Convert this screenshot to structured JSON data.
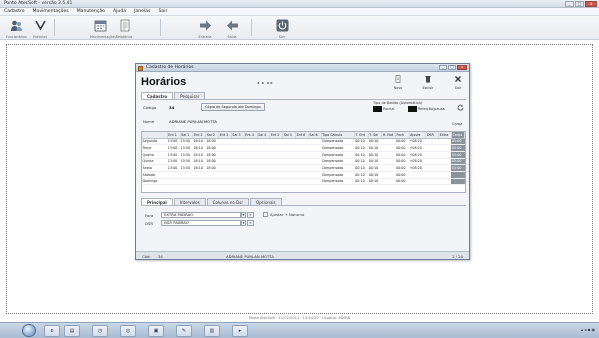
{
  "app": {
    "title": "Ponto AtecSoft - versão 3.5.41",
    "menu": [
      "Cadastro",
      "Movimentações",
      "Manutenção",
      "Ajuda",
      "Janelas",
      "Sair"
    ],
    "toolbar": [
      {
        "label": "Funcionários",
        "icon": "people-icon"
      },
      {
        "label": "Horários",
        "icon": "clock-icon"
      },
      {
        "label": "Movimentações",
        "icon": "calendar-icon"
      },
      {
        "label": "Relatórios",
        "icon": "document-icon"
      },
      {
        "label": "Entrada",
        "icon": "arrow-right-icon"
      },
      {
        "label": "Saída",
        "icon": "arrow-left-icon"
      },
      {
        "label": "Sair",
        "icon": "power-icon"
      }
    ],
    "status_line": "Ponto AtecSoft · 11/02/2013 · 13:44:22 · Usuário: ADMIN"
  },
  "dialog": {
    "title": "Cadastro de Horários",
    "heading": "Horários",
    "nav_text": "◂ ▸ ▸▸",
    "actions": [
      {
        "label": "Novo",
        "icon": "new-icon"
      },
      {
        "label": "Excluir",
        "icon": "delete-icon"
      },
      {
        "label": "Sair",
        "icon": "exit-icon"
      }
    ],
    "tabs": [
      "Cadastro",
      "Pesquisar"
    ],
    "active_tab": "Cadastro",
    "codigo_label": "Código",
    "codigo_value": "34",
    "button_copy": "Cópia de Segunda até Domingo",
    "tipo_label": "Tipo de Batida (Automática)",
    "legend": [
      {
        "label": "Parcial",
        "color": "#111111"
      },
      {
        "label": "Refeição/pausa",
        "color": "#111111"
      }
    ],
    "nome_label": "Nome",
    "nome_value": "ADRIANE PURLAN MOTTA",
    "carga_label": "Carga",
    "grid": {
      "columns": [
        "",
        "Ent 1",
        "Saí 1",
        "Ent 2",
        "Saí 2",
        "Ent 3",
        "Saí 3",
        "Ent 4",
        "Saí 4",
        "Ent 5",
        "Saí 5",
        "Ent 6",
        "Saí 6",
        "Tipo Cálculo",
        "T. Ent",
        "T. Saí",
        "H. Not",
        "Fech",
        "Ajuste",
        "DSR",
        "Extra",
        "Carga"
      ],
      "rows": [
        [
          "Segunda",
          "13:00",
          "15:50",
          "16:10",
          "18:00",
          "",
          "",
          "",
          "",
          "",
          "",
          "",
          "",
          "Compensado",
          "00:10",
          "00:10",
          "",
          "00:00",
          "+08:20",
          "",
          "",
          "05:00"
        ],
        [
          "Terça",
          "13:00",
          "15:50",
          "16:10",
          "18:00",
          "",
          "",
          "",
          "",
          "",
          "",
          "",
          "",
          "Compensado",
          "00:10",
          "00:10",
          "",
          "00:00",
          "+08:20",
          "",
          "",
          "05:00"
        ],
        [
          "Quarta",
          "13:00",
          "15:50",
          "16:10",
          "18:00",
          "",
          "",
          "",
          "",
          "",
          "",
          "",
          "",
          "Compensado",
          "00:10",
          "00:10",
          "",
          "00:00",
          "+08:20",
          "",
          "",
          "05:00"
        ],
        [
          "Quinta",
          "13:00",
          "15:50",
          "16:10",
          "18:00",
          "",
          "",
          "",
          "",
          "",
          "",
          "",
          "",
          "Compensado",
          "00:10",
          "00:10",
          "",
          "00:00",
          "+08:20",
          "",
          "",
          "05:00"
        ],
        [
          "Sexta",
          "13:00",
          "15:50",
          "16:10",
          "18:00",
          "",
          "",
          "",
          "",
          "",
          "",
          "",
          "",
          "Compensado",
          "00:10",
          "00:10",
          "",
          "00:00",
          "+08:20",
          "",
          "",
          "05:00"
        ],
        [
          "Sábado",
          "",
          "",
          "",
          "",
          "",
          "",
          "",
          "",
          "",
          "",
          "",
          "",
          "Compensado",
          "00:10",
          "00:10",
          "",
          "00:00",
          "",
          "",
          "",
          ""
        ],
        [
          "Domingo",
          "",
          "",
          "",
          "",
          "",
          "",
          "",
          "",
          "",
          "",
          "",
          "",
          "Compensado",
          "00:10",
          "00:10",
          "",
          "00:00",
          "",
          "",
          "",
          ""
        ]
      ]
    },
    "subtabs": [
      "Principal",
      "Intervalos",
      "Colunas no Dsr",
      "Opcionais"
    ],
    "active_subtab": "Principal",
    "fields": [
      {
        "label": "Fora",
        "value": "EXTRA PADRÃO"
      },
      {
        "label": "DSR",
        "value": "DSR PADRÃO"
      }
    ],
    "checkbox_label": "Ajustar + Noturno",
    "status": {
      "left": "Cód:",
      "code": "34",
      "name": "ADRIANE PURLAN MOTTA",
      "page": "1 / 20"
    }
  }
}
